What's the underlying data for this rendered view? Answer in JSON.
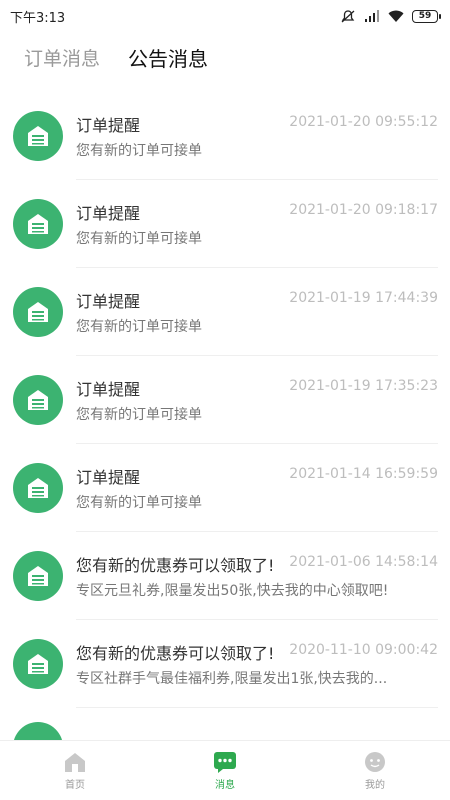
{
  "status_bar": {
    "time": "下午3:13",
    "battery": "59"
  },
  "tabs": [
    {
      "label": "订单消息",
      "active": false
    },
    {
      "label": "公告消息",
      "active": true
    }
  ],
  "messages": [
    {
      "title": "订单提醒",
      "time": "2021-01-20 09:55:12",
      "desc": "您有新的订单可接单"
    },
    {
      "title": "订单提醒",
      "time": "2021-01-20 09:18:17",
      "desc": "您有新的订单可接单"
    },
    {
      "title": "订单提醒",
      "time": "2021-01-19 17:44:39",
      "desc": "您有新的订单可接单"
    },
    {
      "title": "订单提醒",
      "time": "2021-01-19 17:35:23",
      "desc": "您有新的订单可接单"
    },
    {
      "title": "订单提醒",
      "time": "2021-01-14 16:59:59",
      "desc": "您有新的订单可接单"
    },
    {
      "title": "您有新的优惠券可以领取了!",
      "time": "2021-01-06 14:58:14",
      "desc": "专区元旦礼券,限量发出50张,快去我的中心领取吧!"
    },
    {
      "title": "您有新的优惠券可以领取了!",
      "time": "2020-11-10 09:00:42",
      "desc": "专区社群手气最佳福利券,限量发出1张,快去我的..."
    }
  ],
  "bottom_nav": [
    {
      "label": "首页",
      "icon": "home-icon",
      "active": false
    },
    {
      "label": "消息",
      "icon": "message-icon",
      "active": true
    },
    {
      "label": "我的",
      "icon": "profile-icon",
      "active": false
    }
  ],
  "colors": {
    "accent": "#2ea94f",
    "avatar": "#3cb371",
    "inactive": "#9a9a9a"
  }
}
